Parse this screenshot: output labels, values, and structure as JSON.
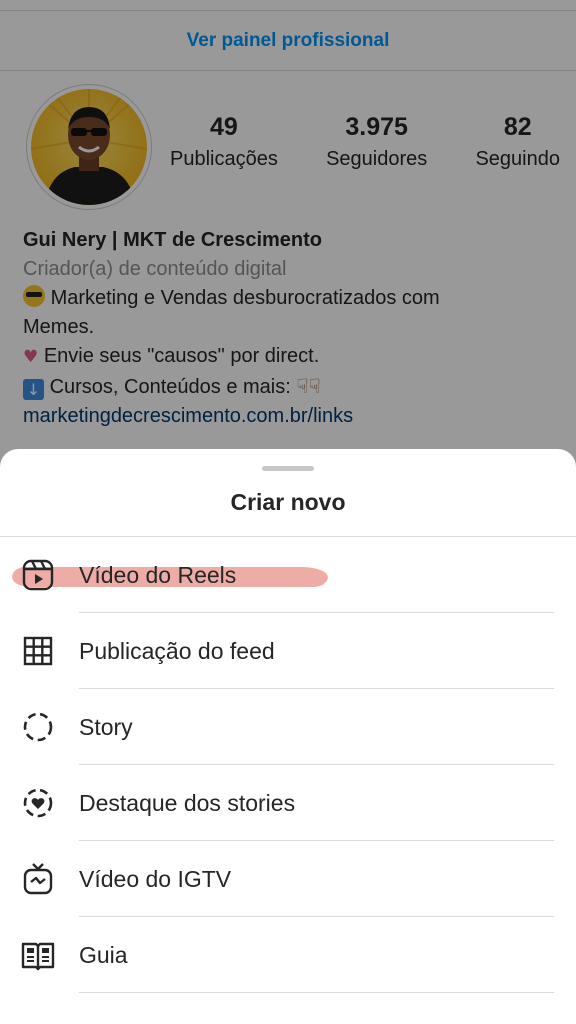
{
  "profile": {
    "professional_panel": "Ver painel profissional",
    "stats": [
      {
        "value": "49",
        "label": "Publicações"
      },
      {
        "value": "3.975",
        "label": "Seguidores"
      },
      {
        "value": "82",
        "label": "Seguindo"
      }
    ],
    "name": "Gui Nery | MKT de Crescimento",
    "category": "Criador(a) de conteúdo digital",
    "bio_line1": "Marketing e Vendas desburocratizados com",
    "bio_line2": "Memes.",
    "bio_line3": "Envie seus \"causos\" por direct.",
    "bio_line4": "Cursos, Conteúdos e mais:",
    "link": "marketingdecrescimento.com.br/links"
  },
  "sheet": {
    "title": "Criar novo",
    "items": [
      {
        "label": "Vídeo do Reels",
        "icon": "reels-icon",
        "highlighted": true
      },
      {
        "label": "Publicação do feed",
        "icon": "grid-icon"
      },
      {
        "label": "Story",
        "icon": "story-icon"
      },
      {
        "label": "Destaque dos stories",
        "icon": "highlight-heart-icon"
      },
      {
        "label": "Vídeo do IGTV",
        "icon": "igtv-icon"
      },
      {
        "label": "Guia",
        "icon": "guide-icon"
      }
    ]
  },
  "colors": {
    "link_blue": "#0095f6",
    "text": "#262626",
    "highlight_marker": "#eba39c"
  }
}
